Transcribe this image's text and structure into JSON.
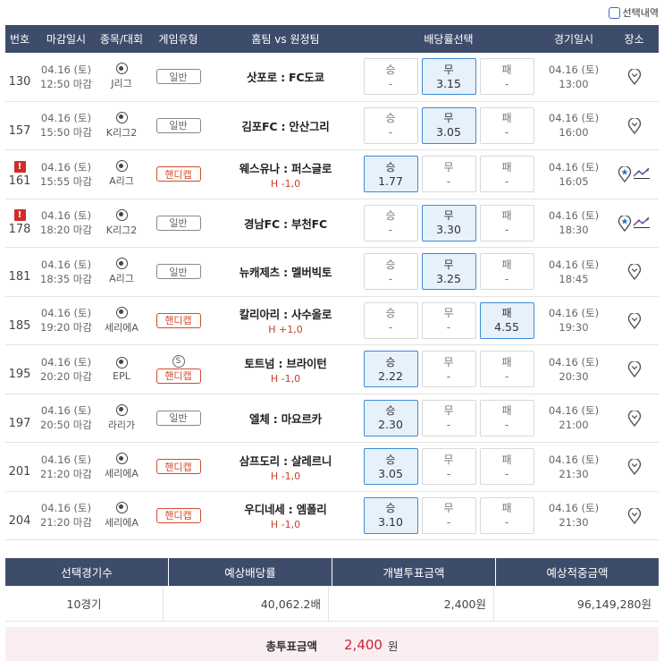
{
  "select_history": "선택내역",
  "headers": {
    "no": "번호",
    "deadline": "마감일시",
    "league": "종목/대회",
    "type": "게임유형",
    "match": "홈팀 vs 원정팀",
    "odds": "배당률선택",
    "datetime": "경기일시",
    "place": "장소"
  },
  "games": [
    {
      "no": "130",
      "alert": false,
      "dl_date": "04.16 (토)",
      "dl_time": "12:50 마감",
      "league": "J리그",
      "s": false,
      "type": "일반",
      "hc": false,
      "match": "삿포로 : FC도쿄",
      "hnum": "",
      "odds": [
        {
          "l": "승",
          "v": "-",
          "sel": false
        },
        {
          "l": "무",
          "v": "3.15",
          "sel": true
        },
        {
          "l": "패",
          "v": "-",
          "sel": false
        }
      ],
      "dt_date": "04.16 (토)",
      "dt_time": "13:00",
      "chart": false
    },
    {
      "no": "157",
      "alert": false,
      "dl_date": "04.16 (토)",
      "dl_time": "15:50 마감",
      "league": "K리그2",
      "s": false,
      "type": "일반",
      "hc": false,
      "match": "김포FC : 안산그리",
      "hnum": "",
      "odds": [
        {
          "l": "승",
          "v": "-",
          "sel": false
        },
        {
          "l": "무",
          "v": "3.05",
          "sel": true
        },
        {
          "l": "패",
          "v": "-",
          "sel": false
        }
      ],
      "dt_date": "04.16 (토)",
      "dt_time": "16:00",
      "chart": false
    },
    {
      "no": "161",
      "alert": true,
      "dl_date": "04.16 (토)",
      "dl_time": "15:55 마감",
      "league": "A리그",
      "s": false,
      "type": "핸디캡",
      "hc": true,
      "match": "웨스유나 : 퍼스글로",
      "hnum": "H -1,0",
      "odds": [
        {
          "l": "승",
          "v": "1.77",
          "sel": true
        },
        {
          "l": "무",
          "v": "-",
          "sel": false
        },
        {
          "l": "패",
          "v": "-",
          "sel": false
        }
      ],
      "dt_date": "04.16 (토)",
      "dt_time": "16:05",
      "chart": true
    },
    {
      "no": "178",
      "alert": true,
      "dl_date": "04.16 (토)",
      "dl_time": "18:20 마감",
      "league": "K리그2",
      "s": false,
      "type": "일반",
      "hc": false,
      "match": "경남FC : 부천FC",
      "hnum": "",
      "odds": [
        {
          "l": "승",
          "v": "-",
          "sel": false
        },
        {
          "l": "무",
          "v": "3.30",
          "sel": true
        },
        {
          "l": "패",
          "v": "-",
          "sel": false
        }
      ],
      "dt_date": "04.16 (토)",
      "dt_time": "18:30",
      "chart": true
    },
    {
      "no": "181",
      "alert": false,
      "dl_date": "04.16 (토)",
      "dl_time": "18:35 마감",
      "league": "A리그",
      "s": false,
      "type": "일반",
      "hc": false,
      "match": "뉴캐제츠 : 멜버빅토",
      "hnum": "",
      "odds": [
        {
          "l": "승",
          "v": "-",
          "sel": false
        },
        {
          "l": "무",
          "v": "3.25",
          "sel": true
        },
        {
          "l": "패",
          "v": "-",
          "sel": false
        }
      ],
      "dt_date": "04.16 (토)",
      "dt_time": "18:45",
      "chart": false
    },
    {
      "no": "185",
      "alert": false,
      "dl_date": "04.16 (토)",
      "dl_time": "19:20 마감",
      "league": "세리에A",
      "s": false,
      "type": "핸디캡",
      "hc": true,
      "match": "칼리아리 : 사수올로",
      "hnum": "H +1,0",
      "odds": [
        {
          "l": "승",
          "v": "-",
          "sel": false
        },
        {
          "l": "무",
          "v": "-",
          "sel": false
        },
        {
          "l": "패",
          "v": "4.55",
          "sel": true
        }
      ],
      "dt_date": "04.16 (토)",
      "dt_time": "19:30",
      "chart": false
    },
    {
      "no": "195",
      "alert": false,
      "dl_date": "04.16 (토)",
      "dl_time": "20:20 마감",
      "league": "EPL",
      "s": true,
      "s_label": "S",
      "type": "핸디캡",
      "hc": true,
      "match": "토트넘 : 브라이턴",
      "hnum": "H -1,0",
      "odds": [
        {
          "l": "승",
          "v": "2.22",
          "sel": true
        },
        {
          "l": "무",
          "v": "-",
          "sel": false
        },
        {
          "l": "패",
          "v": "-",
          "sel": false
        }
      ],
      "dt_date": "04.16 (토)",
      "dt_time": "20:30",
      "chart": false
    },
    {
      "no": "197",
      "alert": false,
      "dl_date": "04.16 (토)",
      "dl_time": "20:50 마감",
      "league": "라리가",
      "s": false,
      "type": "일반",
      "hc": false,
      "match": "엘체 : 마요르카",
      "hnum": "",
      "odds": [
        {
          "l": "승",
          "v": "2.30",
          "sel": true
        },
        {
          "l": "무",
          "v": "-",
          "sel": false
        },
        {
          "l": "패",
          "v": "-",
          "sel": false
        }
      ],
      "dt_date": "04.16 (토)",
      "dt_time": "21:00",
      "chart": false
    },
    {
      "no": "201",
      "alert": false,
      "dl_date": "04.16 (토)",
      "dl_time": "21:20 마감",
      "league": "세리에A",
      "s": false,
      "type": "핸디캡",
      "hc": true,
      "match": "삼프도리 : 살레르니",
      "hnum": "H -1,0",
      "odds": [
        {
          "l": "승",
          "v": "3.05",
          "sel": true
        },
        {
          "l": "무",
          "v": "-",
          "sel": false
        },
        {
          "l": "패",
          "v": "-",
          "sel": false
        }
      ],
      "dt_date": "04.16 (토)",
      "dt_time": "21:30",
      "chart": false
    },
    {
      "no": "204",
      "alert": false,
      "dl_date": "04.16 (토)",
      "dl_time": "21:20 마감",
      "league": "세리에A",
      "s": false,
      "type": "핸디캡",
      "hc": true,
      "match": "우디네세 : 엠폴리",
      "hnum": "H -1,0",
      "odds": [
        {
          "l": "승",
          "v": "3.10",
          "sel": true
        },
        {
          "l": "무",
          "v": "-",
          "sel": false
        },
        {
          "l": "패",
          "v": "-",
          "sel": false
        }
      ],
      "dt_date": "04.16 (토)",
      "dt_time": "21:30",
      "chart": false
    }
  ],
  "summary": {
    "headers": [
      "선택경기수",
      "예상배당률",
      "개별투표금액",
      "예상적중금액"
    ],
    "values": [
      "10경기",
      "40,062.2배",
      "2,400원",
      "96,149,280원"
    ],
    "total_label": "총투표금액",
    "total_amount": "2,400",
    "total_unit": "원"
  },
  "colors": {
    "header_bg": "#3e4c6b",
    "selected_bg": "#e6f1fb",
    "selected_border": "#3e8bd6",
    "handicap": "#d34a2b",
    "alert": "#d32b2b",
    "total_bg": "#fbeef0",
    "total_amount": "#c8253f"
  }
}
